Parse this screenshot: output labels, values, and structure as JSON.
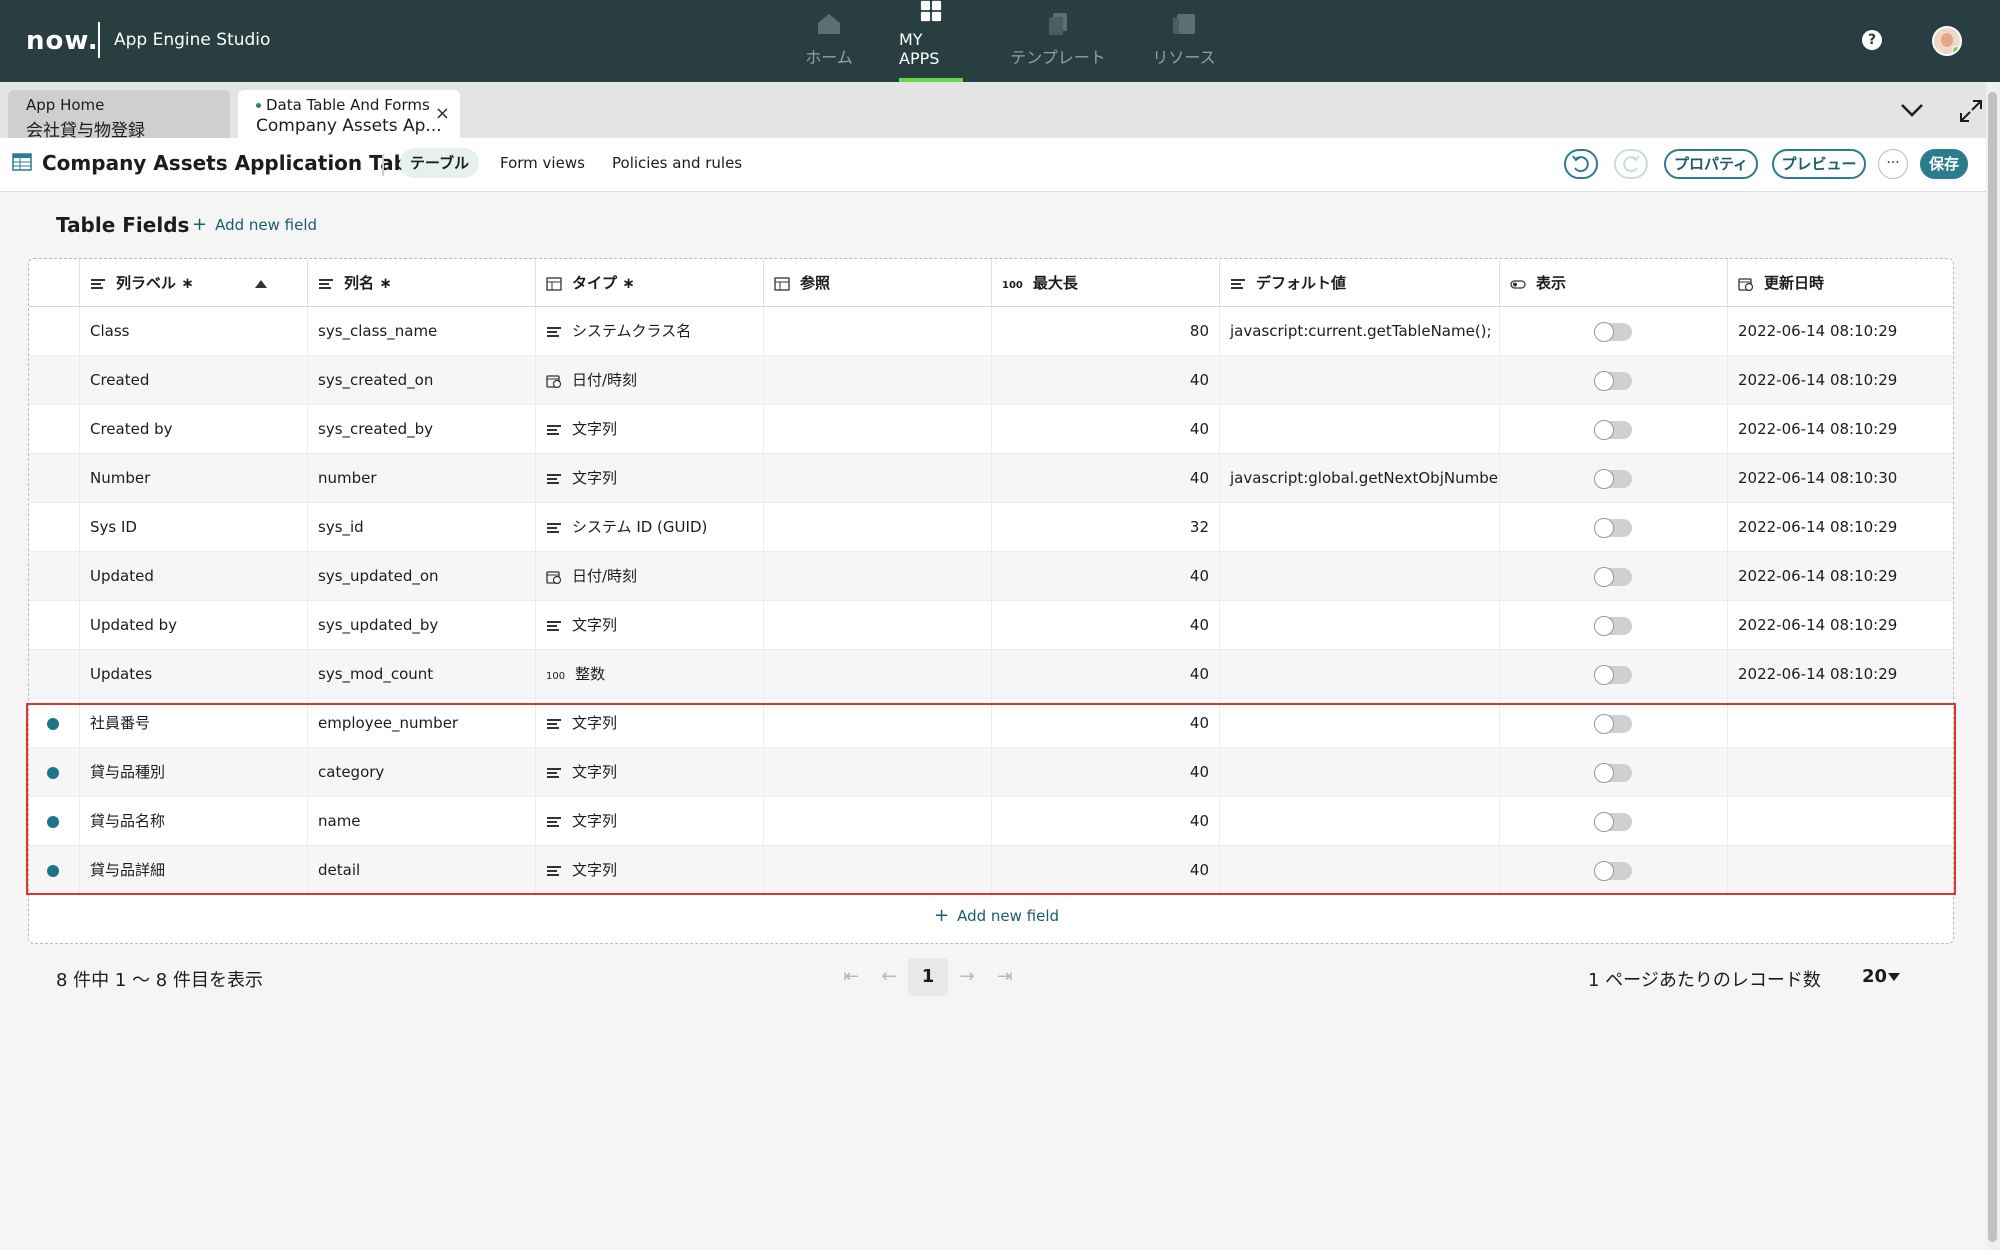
{
  "topbar": {
    "logo": "now.",
    "app_name": "App Engine Studio",
    "nav": [
      {
        "label": "ホーム",
        "icon": "home-icon"
      },
      {
        "label": "MY APPS",
        "icon": "apps-grid-icon"
      },
      {
        "label": "テンプレート",
        "icon": "templates-icon"
      },
      {
        "label": "リソース",
        "icon": "resources-icon"
      }
    ],
    "help": "?"
  },
  "tabs": [
    {
      "line1": "App Home",
      "line2": "会社貸与物登録"
    },
    {
      "line1": "Data Table And Forms",
      "line2": "Company Assets Ap...",
      "close": "×"
    }
  ],
  "toolbar": {
    "title": "Company Assets Application Table",
    "tabs": [
      "テーブル",
      "Form views",
      "Policies and rules"
    ],
    "buttons": {
      "properties": "プロパティ",
      "preview": "プレビュー",
      "more": "···",
      "save": "保存"
    }
  },
  "section": {
    "title": "Table Fields",
    "add_field": "Add new field",
    "add_field_bottom": "Add new field"
  },
  "columns": [
    "列ラベル ∗",
    "列名 ∗",
    "タイプ ∗",
    "参照",
    "最大長",
    "デフォルト値",
    "表示",
    "更新日時"
  ],
  "length_icon_text": "100",
  "rows": [
    {
      "label": "Class",
      "name": "sys_class_name",
      "type": "システムクラス名",
      "type_icon": "text",
      "ref": "",
      "maxlen": "80",
      "default": "javascript:current.getTableName();",
      "updated": "2022-06-14 08:10:29",
      "new": false
    },
    {
      "label": "Created",
      "name": "sys_created_on",
      "type": "日付/時刻",
      "type_icon": "datetime",
      "ref": "",
      "maxlen": "40",
      "default": "",
      "updated": "2022-06-14 08:10:29",
      "new": false
    },
    {
      "label": "Created by",
      "name": "sys_created_by",
      "type": "文字列",
      "type_icon": "text",
      "ref": "",
      "maxlen": "40",
      "default": "",
      "updated": "2022-06-14 08:10:29",
      "new": false
    },
    {
      "label": "Number",
      "name": "number",
      "type": "文字列",
      "type_icon": "text",
      "ref": "",
      "maxlen": "40",
      "default": "javascript:global.getNextObjNumber...",
      "updated": "2022-06-14 08:10:30",
      "new": false
    },
    {
      "label": "Sys ID",
      "name": "sys_id",
      "type": "システム ID (GUID)",
      "type_icon": "text",
      "ref": "",
      "maxlen": "32",
      "default": "",
      "updated": "2022-06-14 08:10:29",
      "new": false
    },
    {
      "label": "Updated",
      "name": "sys_updated_on",
      "type": "日付/時刻",
      "type_icon": "datetime",
      "ref": "",
      "maxlen": "40",
      "default": "",
      "updated": "2022-06-14 08:10:29",
      "new": false
    },
    {
      "label": "Updated by",
      "name": "sys_updated_by",
      "type": "文字列",
      "type_icon": "text",
      "ref": "",
      "maxlen": "40",
      "default": "",
      "updated": "2022-06-14 08:10:29",
      "new": false
    },
    {
      "label": "Updates",
      "name": "sys_mod_count",
      "type": "整数",
      "type_icon": "integer",
      "ref": "",
      "maxlen": "40",
      "default": "",
      "updated": "2022-06-14 08:10:29",
      "new": false
    },
    {
      "label": "社員番号",
      "name": "employee_number",
      "type": "文字列",
      "type_icon": "text",
      "ref": "",
      "maxlen": "40",
      "default": "",
      "updated": "",
      "new": true
    },
    {
      "label": "貸与品種別",
      "name": "category",
      "type": "文字列",
      "type_icon": "text",
      "ref": "",
      "maxlen": "40",
      "default": "",
      "updated": "",
      "new": true
    },
    {
      "label": "貸与品名称",
      "name": "name",
      "type": "文字列",
      "type_icon": "text",
      "ref": "",
      "maxlen": "40",
      "default": "",
      "updated": "",
      "new": true
    },
    {
      "label": "貸与品詳細",
      "name": "detail",
      "type": "文字列",
      "type_icon": "text",
      "ref": "",
      "maxlen": "40",
      "default": "",
      "updated": "",
      "new": true
    }
  ],
  "footer": {
    "count_text": "8 件中 1 〜 8 件目を表示",
    "current_page": "1",
    "per_page_label": "1 ページあたりのレコード数",
    "per_page_value": "20"
  },
  "colors": {
    "topbar": "#293e40",
    "accent": "#2b7c8d",
    "highlight": "#e0352b",
    "nav_active": "#62d84e"
  }
}
